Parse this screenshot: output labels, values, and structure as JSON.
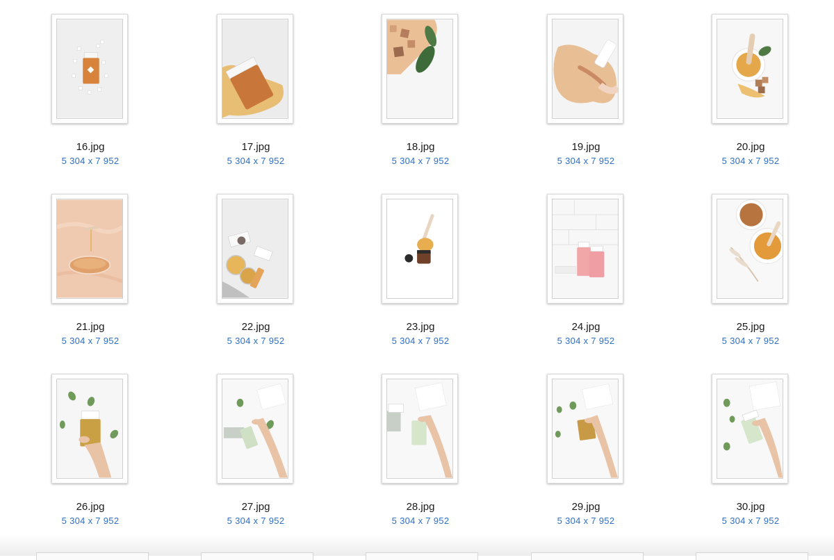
{
  "files": [
    {
      "name": "16.jpg",
      "dims": "5 304 x 7 952",
      "preview": "wax-cartridge-sugar-cubes-icon"
    },
    {
      "name": "17.jpg",
      "dims": "5 304 x 7 952",
      "preview": "wax-cartridge-honey-spill-icon"
    },
    {
      "name": "18.jpg",
      "dims": "5 304 x 7 952",
      "preview": "sugar-cubes-leaves-icon"
    },
    {
      "name": "19.jpg",
      "dims": "5 304 x 7 952",
      "preview": "wax-puddle-hand-icon"
    },
    {
      "name": "20.jpg",
      "dims": "5 304 x 7 952",
      "preview": "honey-jar-spatula-icon"
    },
    {
      "name": "21.jpg",
      "dims": "5 304 x 7 952",
      "preview": "wax-petri-dish-icon"
    },
    {
      "name": "22.jpg",
      "dims": "5 304 x 7 952",
      "preview": "glass-jars-flatlay-icon"
    },
    {
      "name": "23.jpg",
      "dims": "5 304 x 7 952",
      "preview": "amber-jar-spatula-icon"
    },
    {
      "name": "24.jpg",
      "dims": "5 304 x 7 952",
      "preview": "pink-wax-cartridges-icon"
    },
    {
      "name": "25.jpg",
      "dims": "5 304 x 7 952",
      "preview": "wax-bowls-pampas-icon"
    },
    {
      "name": "26.jpg",
      "dims": "5 304 x 7 952",
      "preview": "hand-gold-cartridge-icon"
    },
    {
      "name": "27.jpg",
      "dims": "5 304 x 7 952",
      "preview": "hand-green-cartridge-icon"
    },
    {
      "name": "28.jpg",
      "dims": "5 304 x 7 952",
      "preview": "hand-green-cartridge-icon"
    },
    {
      "name": "29.jpg",
      "dims": "5 304 x 7 952",
      "preview": "hand-gold-cartridge-icon"
    },
    {
      "name": "30.jpg",
      "dims": "5 304 x 7 952",
      "preview": "hand-green-cartridge-icon"
    }
  ],
  "colors": {
    "dims_text": "#2f6fc4",
    "name_text": "#1a1a1a",
    "honey": "#e0a85a",
    "amber": "#c98a4a",
    "leaf": "#4f7a45",
    "pink": "#f1a6a8",
    "skin": "#e9c3a6"
  }
}
